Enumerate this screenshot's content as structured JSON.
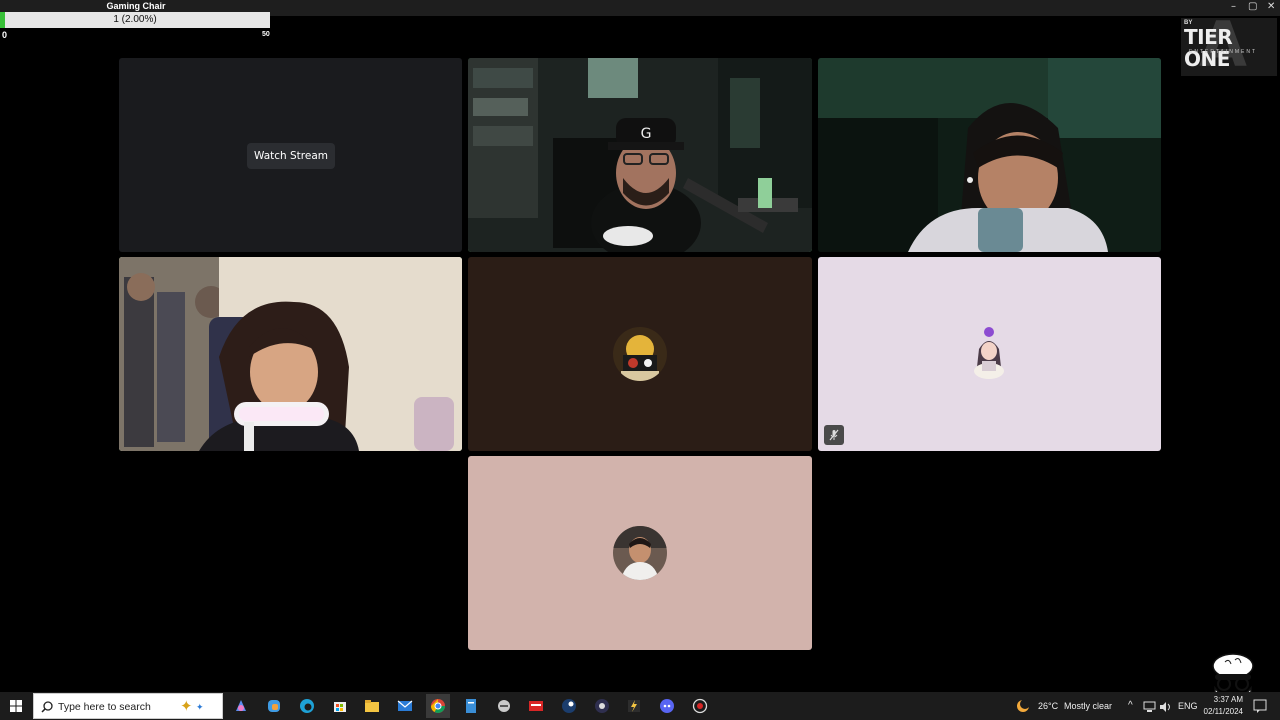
{
  "goal": {
    "title": "Gaming Chair",
    "progress_text": "1 (2.00%)",
    "progress_fraction": 0.02,
    "min": "0",
    "max": "50"
  },
  "logo": {
    "by": "BY",
    "main": "TIER ONE",
    "sub": "ENTERTAINMENT"
  },
  "call": {
    "stream_tile": {
      "watch_label": "Watch Stream"
    }
  },
  "taskbar": {
    "search_placeholder": "Type here to search",
    "weather_temp": "26°C",
    "weather_text": "Mostly clear",
    "language": "ENG",
    "time": "3:37 AM",
    "date": "02/11/2024"
  }
}
